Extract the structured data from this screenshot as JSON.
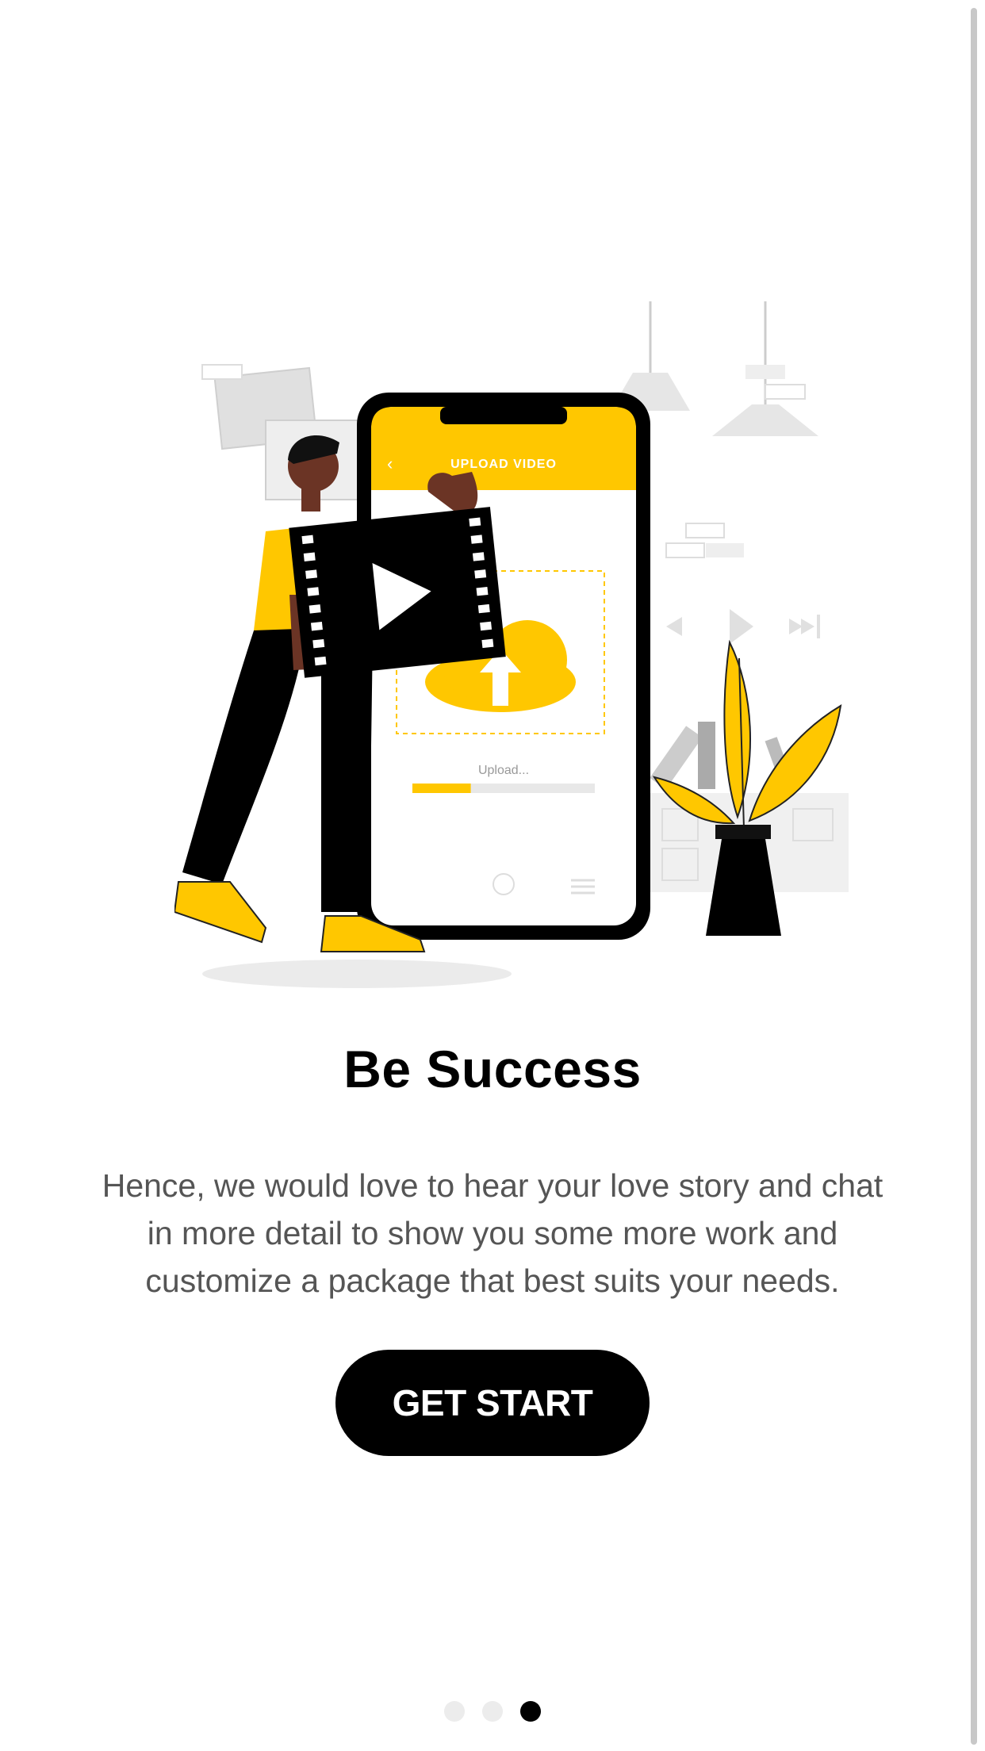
{
  "illustration": {
    "icon": "upload-video-illustration",
    "phone_header": "UPLOAD VIDEO",
    "upload_status": "Upload...",
    "upload_progress": 0.32,
    "accent_color": "#FFC700"
  },
  "onboarding": {
    "title": "Be Success",
    "description": "Hence, we would love to hear your love story and chat in more detail to show you some more work and customize a package that best suits your needs.",
    "cta_label": "GET START"
  },
  "pager": {
    "total": 3,
    "active_index": 2
  }
}
